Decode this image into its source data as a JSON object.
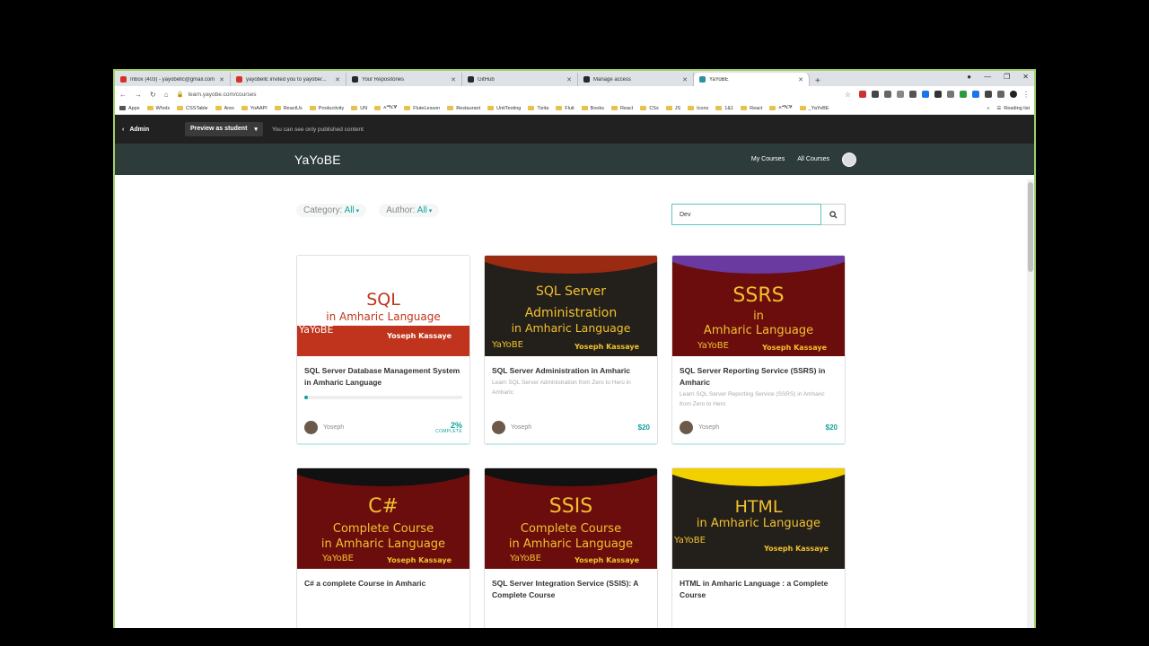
{
  "browser": {
    "tabs": [
      {
        "label": "Inbox (403) - yayobellc@gmail.com",
        "fav_color": "#d93025",
        "fav_letter": "M",
        "active": false
      },
      {
        "label": "yayobellc invited you to yayobe/...",
        "fav_color": "#d93025",
        "fav_letter": "M",
        "active": false
      },
      {
        "label": "Your Repositories",
        "fav_color": "#24292e",
        "fav_letter": "",
        "active": false
      },
      {
        "label": "GitHub",
        "fav_color": "#24292e",
        "fav_letter": "",
        "active": false
      },
      {
        "label": "Manage access",
        "fav_color": "#24292e",
        "fav_letter": "",
        "active": false
      },
      {
        "label": "YaYoBE",
        "fav_color": "#2d8fa8",
        "fav_letter": "",
        "active": true
      }
    ],
    "url": "learn.yayobe.com/courses",
    "bookmarks": [
      "Apps",
      "WhoIs",
      "CSSTable",
      "Ares",
      "YoAAPI",
      "ReactUs",
      "Productivity",
      "UN",
      "አማርኛ",
      "FluteLesson",
      "Restaurant",
      "UnitTesting",
      "Tizita",
      "Fluit",
      "Books",
      "React",
      "CSs",
      "JS",
      "Icons",
      "1&1",
      "React",
      "አማርኛ",
      "_YaYoBE"
    ],
    "reading_list": "Reading list"
  },
  "admin_bar": {
    "back_label": "Admin",
    "preview_label": "Preview as student",
    "note": "You can see only published content"
  },
  "school_nav": {
    "brand": "YaYoBE",
    "my_courses": "My Courses",
    "all_courses": "All Courses"
  },
  "filters": {
    "category_label": "Category:",
    "category_value": "All",
    "author_label": "Author:",
    "author_value": "All"
  },
  "search": {
    "value": "Dev"
  },
  "courses": [
    {
      "title": "SQL Server Database Management System in Amharic Language",
      "subtitle": "",
      "author": "Yoseph",
      "progress": 0.02,
      "progress_label": "2%",
      "progress_caption": "COMPLETE",
      "thumb": {
        "line1": "SQL",
        "line2": "in Amharic Language",
        "brand": "YaYoBE",
        "author": "Yoseph Kassaye"
      }
    },
    {
      "title": "SQL Server Administration in Amharic",
      "subtitle": "Learn SQL Server Administration from Zero to Hero in Amharic",
      "author": "Yoseph",
      "price": "$20",
      "thumb": {
        "line1": "SQL Server",
        "line2": "Administration",
        "line3": "in Amharic Language",
        "brand": "YaYoBE",
        "author": "Yoseph Kassaye"
      }
    },
    {
      "title": "SQL Server Reporting Service (SSRS) in Amharic",
      "subtitle": "Learn SQL Server Reporting Service (SSRS) in Amharic from Zero to Hero",
      "author": "Yoseph",
      "price": "$20",
      "thumb": {
        "line1": "SSRS",
        "line2": "in",
        "line3": "Amharic Language",
        "brand": "YaYoBE",
        "author": "Yoseph Kassaye"
      }
    },
    {
      "title": "C# a complete Course in Amharic",
      "subtitle": "",
      "thumb": {
        "line1": "C#",
        "line2": "Complete Course",
        "line3": "in Amharic Language",
        "brand": "YaYoBE",
        "author": "Yoseph Kassaye"
      }
    },
    {
      "title": "SQL Server Integration Service (SSIS): A Complete Course",
      "subtitle": "",
      "thumb": {
        "line1": "SSIS",
        "line2": "Complete Course",
        "line3": "in Amharic Language",
        "brand": "YaYoBE",
        "author": "Yoseph Kassaye"
      }
    },
    {
      "title": "HTML in Amharic Language : a Complete Course",
      "subtitle": "",
      "thumb": {
        "line1": "HTML",
        "line2": "in Amharic Language",
        "brand": "YaYoBE",
        "author": "Yoseph Kassaye"
      }
    }
  ],
  "colors": {
    "accent": "#11a29d",
    "nav_bg": "#2d3b3b",
    "admin_bg": "#212121",
    "thumb_red": "#c0341d",
    "thumb_maroon": "#6b0d0d",
    "thumb_dark": "#231f1a",
    "thumb_purple": "#6a3aa0",
    "thumb_yellow": "#f2c12e",
    "thumb_black": "#111111"
  }
}
